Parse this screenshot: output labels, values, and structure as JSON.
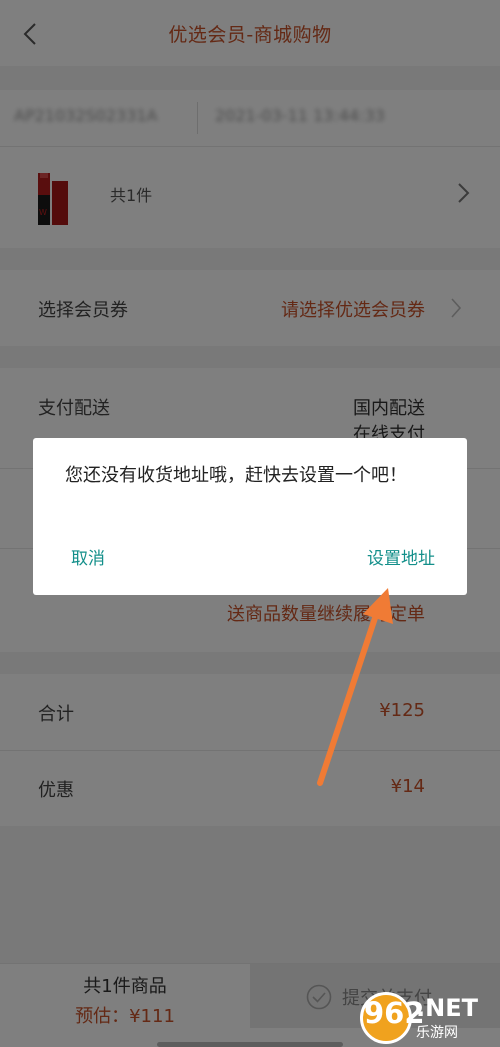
{
  "header": {
    "title": "优选会员-商城购物"
  },
  "order": {
    "number": "AP21032S02331A",
    "time": "2021-03-11 13:44:33"
  },
  "goods": {
    "count_text": "共1件"
  },
  "coupon": {
    "label": "选择会员券",
    "value": "请选择优选会员券"
  },
  "payment": {
    "label": "支付配送",
    "delivery": "国内配送",
    "method": "在线支付",
    "note": "送商品数量继续履行定单"
  },
  "totals": {
    "total_label": "合计",
    "total_value": "¥125",
    "discount_label": "优惠",
    "discount_value": "¥14"
  },
  "bottom": {
    "count_text": "共1件商品",
    "estimate_text": "预估：¥111",
    "submit_label": "提交并支付"
  },
  "dialog": {
    "message": "您还没有收货地址哦，赶快去设置一个吧！",
    "cancel_label": "取消",
    "confirm_label": "设置地址"
  },
  "watermark": {
    "number": "962",
    "suffix": ".NET",
    "chinese": "乐游网"
  },
  "colors": {
    "accent": "#c8522a",
    "dialog_button": "#138f8a",
    "arrow": "#f07b35"
  }
}
